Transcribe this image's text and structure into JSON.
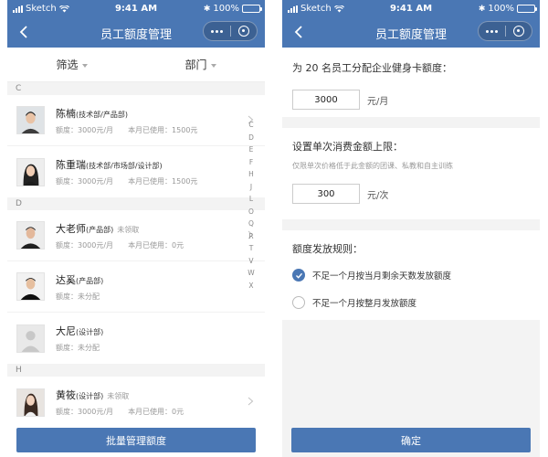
{
  "status_bar": {
    "carrier": "Sketch",
    "time": "9:41 AM",
    "battery": "100%",
    "battery_level": 1.0
  },
  "nav": {
    "title": "员工额度管理"
  },
  "colors": {
    "primary": "#4a77b4",
    "section_bg": "#f3f3f3",
    "muted_text": "#999999"
  },
  "left": {
    "filters": [
      "筛选",
      "部门"
    ],
    "index_letters": [
      "C",
      "D",
      "E",
      "F",
      "H",
      "J",
      "L",
      "O",
      "Q",
      "R",
      "T",
      "V",
      "W",
      "X"
    ],
    "sections": [
      {
        "letter": "C",
        "employees": [
          {
            "name": "陈楠",
            "dept": "(技术部/产品部)",
            "status": "",
            "quota": "额度：3000元/月",
            "used": "本月已使用：1500元",
            "avatar": "man-short-hair"
          },
          {
            "name": "陈重瑞",
            "dept": "(技术部/市场部/设计部)",
            "status": "",
            "quota": "额度：3000元/月",
            "used": "本月已使用：1500元",
            "avatar": "woman-long-hair"
          }
        ]
      },
      {
        "letter": "D",
        "employees": [
          {
            "name": "大老师",
            "dept": "(产品部)",
            "status": "未领取",
            "quota": "额度：3000元/月",
            "used": "本月已使用：0元",
            "avatar": "man-dark-shirt"
          },
          {
            "name": "达奚",
            "dept": "(产品部)",
            "status": "",
            "quota": "额度：未分配",
            "used": "",
            "avatar": "man-black-shirt"
          },
          {
            "name": "大尼",
            "dept": "(设计部)",
            "status": "",
            "quota": "额度：未分配",
            "used": "",
            "avatar": "default-avatar"
          }
        ]
      },
      {
        "letter": "H",
        "employees": [
          {
            "name": "黄筱",
            "dept": "(设计部)",
            "status": "未领取",
            "quota": "额度：3000元/月",
            "used": "本月已使用：0元",
            "avatar": "woman-portrait"
          }
        ]
      }
    ],
    "bottom_button": "批量管理额度"
  },
  "right": {
    "assign_title": "为 20 名员工分配企业健身卡额度：",
    "monthly_value": "3000",
    "monthly_unit": "元/月",
    "limit_title": "设置单次消费金额上限：",
    "limit_hint": "仅限单次价格低于此金额的团课、私教和自主训练",
    "limit_value": "300",
    "limit_unit": "元/次",
    "rule_title": "额度发放规则：",
    "rules": [
      {
        "label": "不足一个月按当月剩余天数发放额度",
        "checked": true
      },
      {
        "label": "不足一个月按整月发放额度",
        "checked": false
      }
    ],
    "confirm_button": "确定"
  }
}
